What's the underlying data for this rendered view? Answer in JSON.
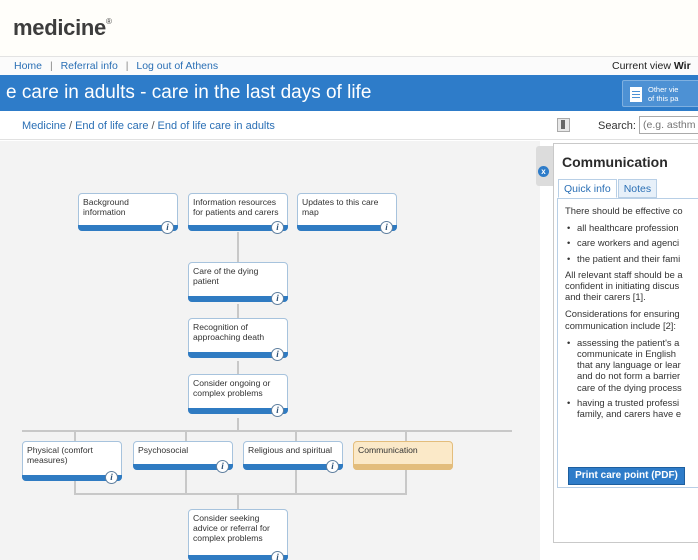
{
  "brand": {
    "logo_text": "medicine",
    "logo_mark": "®"
  },
  "nav": {
    "links": [
      "Home",
      "Referral info",
      "Log out of Athens"
    ],
    "separator": "|",
    "current_view_label": "Current view",
    "current_view_value": "Wir"
  },
  "title_bar": {
    "title": "e care in adults - care in the last days of life",
    "other_views_label": "Other vie\nof this pa"
  },
  "breadcrumb": {
    "items": [
      "Medicine",
      "End of life care",
      "End of life care in adults"
    ],
    "separator": "/"
  },
  "search": {
    "label": "Search:",
    "placeholder": "(e.g. asthm"
  },
  "care_map": {
    "nodes": {
      "background_information": "Background information",
      "information_resources": "Information resources for patients and carers",
      "updates": "Updates to this care map",
      "care_of_dying": "Care of the dying patient",
      "recognition": "Recognition of approaching death",
      "consider_ongoing": "Consider ongoing or complex problems",
      "physical": "Physical (comfort measures)",
      "psychosocial": "Psychosocial",
      "religious": "Religious and spiritual",
      "communication": "Communication",
      "consider_seeking": "Consider seeking advice or referral for complex problems"
    },
    "info_glyph": "i"
  },
  "panel": {
    "close_glyph": "x",
    "title": "Communication",
    "tabs": [
      "Quick info",
      "Notes"
    ],
    "selected_tab": "Quick info",
    "intro": "There should be effective co",
    "bullets_1": [
      "all healthcare profession",
      "care workers and agenci",
      "the patient and their fami"
    ],
    "para_2": "All relevant staff should be a\nconfident in initiating discus\nand their carers [1].",
    "para_3": "Considerations for ensuring\ncommunication include [2]:",
    "bullets_2": [
      "assessing the patient's a\ncommunicate in English\nthat any language or lear\nand do not form a barrier\ncare of the dying process",
      "having a trusted professi\nfamily, and carers have e"
    ],
    "print_label": "Print care point (PDF)"
  },
  "colors": {
    "accent": "#2e7cc9",
    "link": "#2a6fb5",
    "active_node": "#fbe9c8",
    "map_background": "#f3f3f3"
  },
  "icons": [
    "info-icon",
    "document-icon",
    "bookmark-icon",
    "close-icon"
  ]
}
